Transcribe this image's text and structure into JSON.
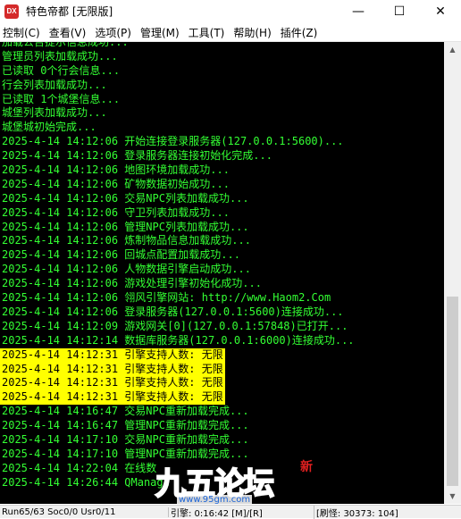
{
  "window": {
    "title": "特色帝都 [无限版]",
    "icon_label": "DX",
    "controls": {
      "minimize": "—",
      "maximize": "☐",
      "close": "✕"
    }
  },
  "menu": [
    "控制(C)",
    "查看(V)",
    "选项(P)",
    "管理(M)",
    "工具(T)",
    "帮助(H)",
    "插件(Z)"
  ],
  "console": {
    "lines": [
      {
        "text": "加载公告提示信息成功...",
        "highlight": false
      },
      {
        "text": "管理员列表加载成功...",
        "highlight": false
      },
      {
        "text": "已读取 0个行会信息...",
        "highlight": false
      },
      {
        "text": "行会列表加载成功...",
        "highlight": false
      },
      {
        "text": "已读取 1个城堡信息...",
        "highlight": false
      },
      {
        "text": "城堡列表加载成功...",
        "highlight": false
      },
      {
        "text": "城堡城初始完成...",
        "highlight": false
      },
      {
        "text": "2025-4-14 14:12:06 开始连接登录服务器(127.0.0.1:5600)...",
        "highlight": false
      },
      {
        "text": "2025-4-14 14:12:06 登录服务器连接初始化完成...",
        "highlight": false
      },
      {
        "text": "2025-4-14 14:12:06 地图环境加载成功...",
        "highlight": false
      },
      {
        "text": "2025-4-14 14:12:06 矿物数据初始成功...",
        "highlight": false
      },
      {
        "text": "2025-4-14 14:12:06 交易NPC列表加载成功...",
        "highlight": false
      },
      {
        "text": "2025-4-14 14:12:06 守卫列表加载成功...",
        "highlight": false
      },
      {
        "text": "2025-4-14 14:12:06 管理NPC列表加载成功...",
        "highlight": false
      },
      {
        "text": "2025-4-14 14:12:06 炼制物品信息加载成功...",
        "highlight": false
      },
      {
        "text": "2025-4-14 14:12:06 回城点配置加载成功...",
        "highlight": false
      },
      {
        "text": "2025-4-14 14:12:06 人物数据引擎启动成功...",
        "highlight": false
      },
      {
        "text": "2025-4-14 14:12:06 游戏处理引擎初始化成功...",
        "highlight": false
      },
      {
        "text": "2025-4-14 14:12:06 翎风引擎网站: http://www.Haom2.Com",
        "highlight": false
      },
      {
        "text": "2025-4-14 14:12:06 登录服务器(127.0.0.1:5600)连接成功...",
        "highlight": false
      },
      {
        "text": "2025-4-14 14:12:09 游戏网关[0](127.0.0.1:57848)已打开...",
        "highlight": false
      },
      {
        "text": "2025-4-14 14:12:14 数据库服务器(127.0.0.1:6000)连接成功...",
        "highlight": false
      },
      {
        "text": "2025-4-14 14:12:31 引擎支持人数: 无限",
        "highlight": true
      },
      {
        "text": "2025-4-14 14:12:31 引擎支持人数: 无限",
        "highlight": true
      },
      {
        "text": "2025-4-14 14:12:31 引擎支持人数: 无限",
        "highlight": true
      },
      {
        "text": "2025-4-14 14:12:31 引擎支持人数: 无限",
        "highlight": true
      },
      {
        "text": "2025-4-14 14:16:47 交易NPC重新加载完成...",
        "highlight": false
      },
      {
        "text": "2025-4-14 14:16:47 管理NPC重新加载完成...",
        "highlight": false
      },
      {
        "text": "2025-4-14 14:17:10 交易NPC重新加载完成...",
        "highlight": false
      },
      {
        "text": "2025-4-14 14:17:10 管理NPC重新加载完成...",
        "highlight": false
      },
      {
        "text": "2025-4-14 14:22:04 在线数",
        "highlight": false
      },
      {
        "text": "2025-4-14 14:26:44 QManage",
        "highlight": false
      }
    ]
  },
  "statusbar": {
    "cell1": "Run65/63 Soc0/0 Usr0/11",
    "cell2": "引擎: 0:16:42 [M]/[R]",
    "cell3": "[刷怪: 30373: 104]"
  },
  "watermark": {
    "logo": "九五论坛",
    "badge": "新",
    "url": "www.95gm.com"
  }
}
